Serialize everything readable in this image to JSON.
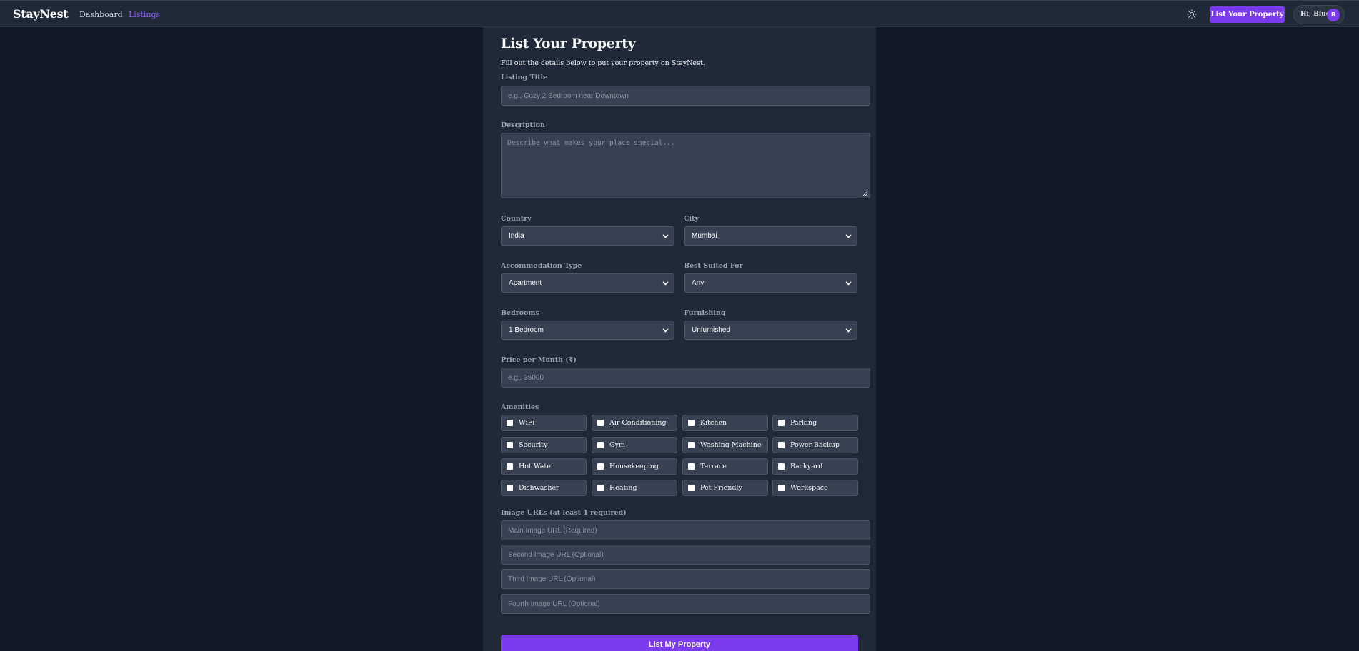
{
  "nav": {
    "brand": "StayNest",
    "links": [
      "Dashboard",
      "Listings"
    ],
    "theme_icon": "sun-icon",
    "list_button": "List Your Property",
    "greeting": "Hi, Blue",
    "avatar_initial": "B"
  },
  "form": {
    "title": "List Your Property",
    "subtitle": "Fill out the details below to put your property on StayNest.",
    "listing_title": {
      "label": "Listing Title",
      "placeholder": "e.g., Cozy 2 Bedroom near Downtown"
    },
    "description": {
      "label": "Description",
      "placeholder": "Describe what makes your place special..."
    },
    "country": {
      "label": "Country",
      "value": "India"
    },
    "city": {
      "label": "City",
      "value": "Mumbai"
    },
    "accommodation": {
      "label": "Accommodation Type",
      "value": "Apartment"
    },
    "best_suited": {
      "label": "Best Suited For",
      "value": "Any"
    },
    "bedrooms": {
      "label": "Bedrooms",
      "value": "1 Bedroom"
    },
    "furnishing": {
      "label": "Furnishing",
      "value": "Unfurnished"
    },
    "price": {
      "label": "Price per Month (₹)",
      "placeholder": "e.g., 35000"
    },
    "amenities_label": "Amenities",
    "amenities": [
      "WiFi",
      "Air Conditioning",
      "Kitchen",
      "Parking",
      "Security",
      "Gym",
      "Washing Machine",
      "Power Backup",
      "Hot Water",
      "Housekeeping",
      "Terrace",
      "Backyard",
      "Dishwasher",
      "Heating",
      "Pet Friendly",
      "Workspace"
    ],
    "images_label": "Image URLs (at least 1 required)",
    "image_placeholders": [
      "Main Image URL (Required)",
      "Second Image URL (Optional)",
      "Third Image URL (Optional)",
      "Fourth Image URL (Optional)"
    ],
    "submit": "List My Property"
  },
  "colors": {
    "accent": "#7c3aed",
    "background": "#111827",
    "panel": "#1f2937",
    "field": "#374151"
  }
}
